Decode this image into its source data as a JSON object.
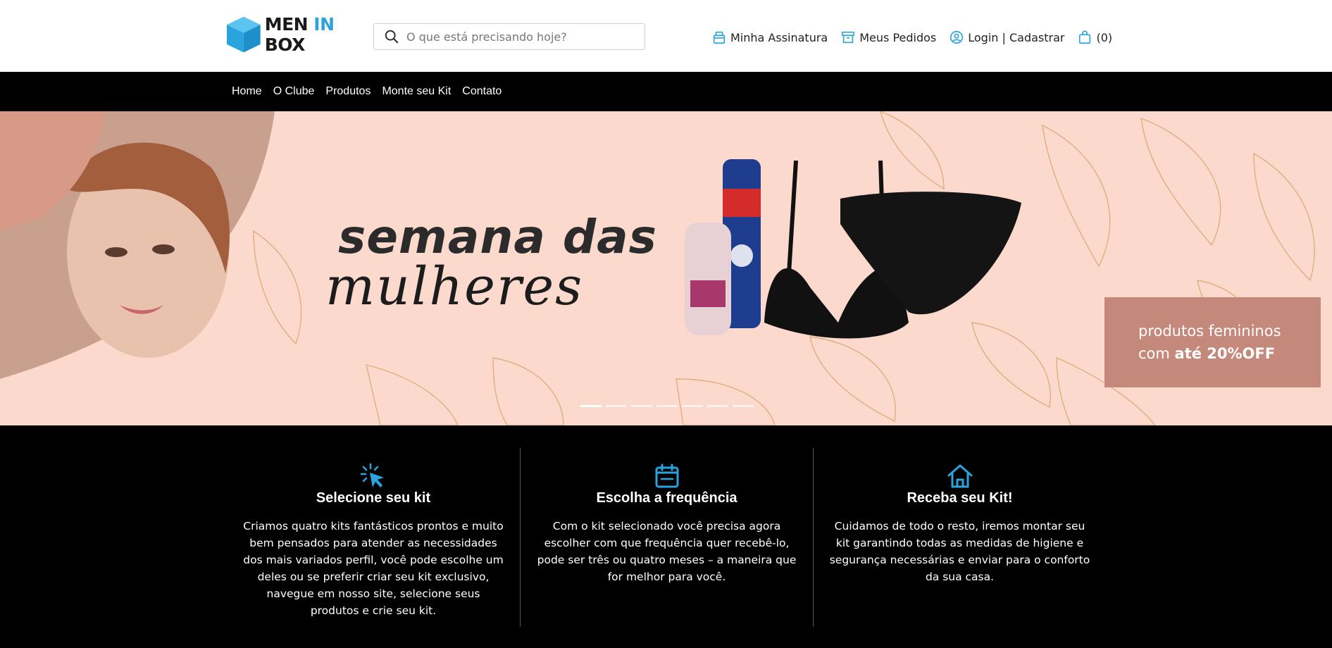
{
  "brand": {
    "part1": "MEN ",
    "part2": "IN",
    "part3": " BOX"
  },
  "search": {
    "placeholder": "O que está precisando hoje?"
  },
  "top_links": {
    "subscription": "Minha Assinatura",
    "orders": "Meus Pedidos",
    "login": "Login | Cadastrar",
    "cart": "(0)"
  },
  "nav": [
    "Home",
    "O Clube",
    "Produtos",
    "Monte seu Kit",
    "Contato"
  ],
  "banner": {
    "headline_line1": "semana das",
    "headline_line2": "mulheres",
    "promo_line1": "produtos femininos",
    "promo_prefix": "com ",
    "promo_highlight": "até 20%OFF",
    "slide_count": 7,
    "active_slide": 0
  },
  "steps": [
    {
      "icon": "pointer-click-icon",
      "title": "Selecione seu kit",
      "text": "Criamos quatro kits fantásticos prontos e muito bem pensados para atender as necessidades dos mais variados perfil, você pode escolhe um deles ou se preferir criar seu kit exclusivo, navegue em nosso site, selecione seus produtos e crie seu kit."
    },
    {
      "icon": "calendar-icon",
      "title": "Escolha a frequência",
      "text": "Com o kit selecionado você precisa agora escolher com que frequência quer recebê-lo, pode ser três ou quatro meses – a maneira que for melhor para você."
    },
    {
      "icon": "home-icon",
      "title": "Receba seu Kit!",
      "text": "Cuidamos de todo o resto, iremos montar seu kit garantindo todas as medidas de higiene e segurança necessárias e enviar para o conforto da sua casa."
    }
  ],
  "colors": {
    "accent": "#2aa3de",
    "promo": "#c4897b",
    "banner_bg": "#fcd9cd"
  }
}
